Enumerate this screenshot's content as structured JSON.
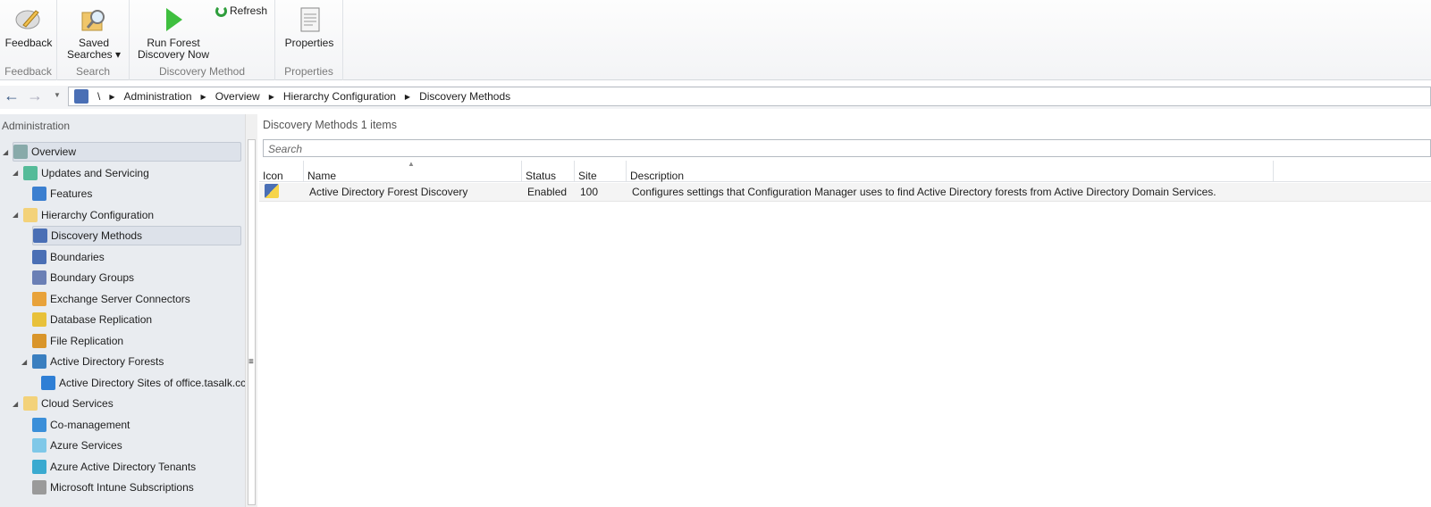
{
  "ribbon": {
    "groups": [
      {
        "label": "Feedback",
        "buttons": [
          {
            "label": "Feedback",
            "icon": "feedback-icon"
          }
        ]
      },
      {
        "label": "Search",
        "buttons": [
          {
            "label": "Saved Searches ▾",
            "icon": "saved-searches-icon"
          }
        ]
      },
      {
        "label": "Discovery Method",
        "buttons": [
          {
            "label": "Run Forest Discovery Now",
            "icon": "play-icon"
          },
          {
            "label": "Refresh",
            "icon": "refresh-icon"
          }
        ]
      },
      {
        "label": "Properties",
        "buttons": [
          {
            "label": "Properties",
            "icon": "properties-icon"
          }
        ]
      }
    ]
  },
  "breadcrumb": [
    "\\",
    "Administration",
    "Overview",
    "Hierarchy Configuration",
    "Discovery Methods"
  ],
  "sidebar": {
    "title": "Administration",
    "items": [
      {
        "label": "Overview"
      },
      {
        "label": "Updates and Servicing"
      },
      {
        "label": "Features"
      },
      {
        "label": "Hierarchy Configuration"
      },
      {
        "label": "Discovery Methods"
      },
      {
        "label": "Boundaries"
      },
      {
        "label": "Boundary Groups"
      },
      {
        "label": "Exchange Server Connectors"
      },
      {
        "label": "Database Replication"
      },
      {
        "label": "File Replication"
      },
      {
        "label": "Active Directory Forests"
      },
      {
        "label": "Active Directory Sites of office.tasalk.cc"
      },
      {
        "label": "Cloud Services"
      },
      {
        "label": "Co-management"
      },
      {
        "label": "Azure Services"
      },
      {
        "label": "Azure Active Directory Tenants"
      },
      {
        "label": "Microsoft Intune Subscriptions"
      }
    ]
  },
  "main": {
    "title": "Discovery Methods 1 items",
    "search_placeholder": "Search",
    "columns": [
      "Icon",
      "Name",
      "Status",
      "Site",
      "Description"
    ],
    "rows": [
      {
        "name": "Active Directory Forest Discovery",
        "status": "Enabled",
        "site": "100",
        "description": "Configures settings that Configuration Manager uses to find Active Directory forests from Active Directory Domain Services."
      }
    ]
  }
}
